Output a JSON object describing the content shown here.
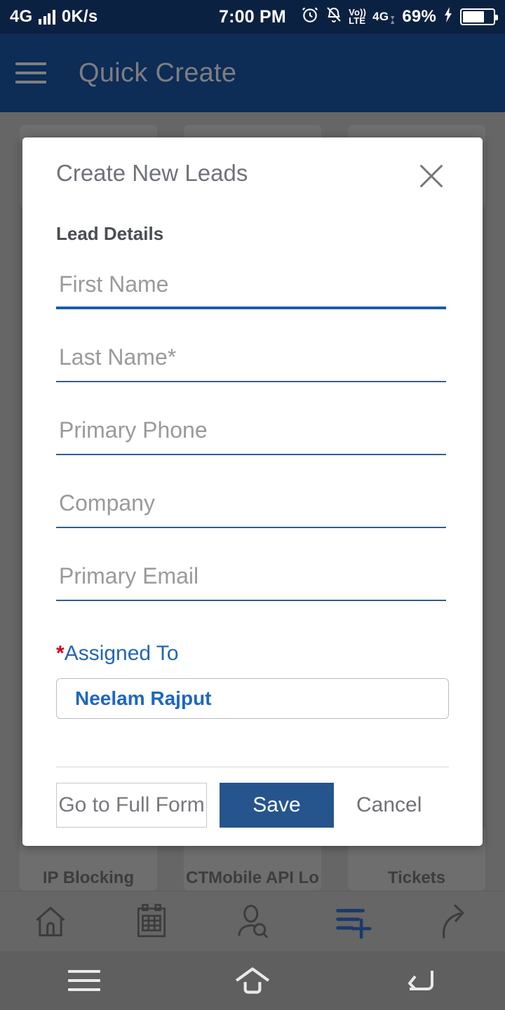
{
  "status_bar": {
    "network_type": "4G",
    "data_rate": "0K/s",
    "time": "7:00 PM",
    "volte_top": "Vo))",
    "volte_bottom": "LTE",
    "second_network": "4G",
    "battery_percent": "69%",
    "icons": [
      "alarm-icon",
      "mute-icon",
      "volte-icon",
      "signal-icon",
      "charging-bolt-icon",
      "battery-icon"
    ],
    "background_color": "#0b2141"
  },
  "app_bar": {
    "title": "Quick Create",
    "menu_icon": "hamburger-icon",
    "background_color": "#0d2c56",
    "title_color": "#7c7e82"
  },
  "background": {
    "top_tiles": [
      "",
      "",
      ""
    ],
    "bottom_tiles": [
      "IP Blocking",
      "CTMobile API Lo",
      "Tickets"
    ]
  },
  "dialog": {
    "title": "Create New Leads",
    "close_icon": "close-icon",
    "section_label": "Lead Details",
    "fields": [
      {
        "placeholder": "First Name",
        "required_mark": "",
        "value": "",
        "focused": true
      },
      {
        "placeholder": "Last Name",
        "required_mark": "*",
        "value": "",
        "focused": false
      },
      {
        "placeholder": "Primary Phone",
        "required_mark": "",
        "value": "",
        "focused": false
      },
      {
        "placeholder": "Company",
        "required_mark": "",
        "value": "",
        "focused": false
      },
      {
        "placeholder": "Primary Email",
        "required_mark": "",
        "value": "",
        "focused": false
      }
    ],
    "assigned_to": {
      "star": "*",
      "label": "Assigned To",
      "value": "Neelam Rajput",
      "label_color": "#2566b0",
      "value_color": "#1f66c0",
      "star_color": "#d0021b"
    },
    "footer": {
      "full_form_label": "Go to Full Form",
      "save_label": "Save",
      "cancel_label": "Cancel",
      "save_color": "#25558c"
    }
  },
  "app_nav": {
    "items": [
      {
        "name": "home-icon",
        "active": false
      },
      {
        "name": "calendar-icon",
        "active": false
      },
      {
        "name": "person-search-icon",
        "active": false
      },
      {
        "name": "quick-create-icon",
        "active": true
      },
      {
        "name": "share-arrow-icon",
        "active": false
      }
    ],
    "active_color": "#1b3a6b"
  },
  "system_nav": {
    "items": [
      "recents-icon",
      "home-icon",
      "back-icon"
    ]
  }
}
